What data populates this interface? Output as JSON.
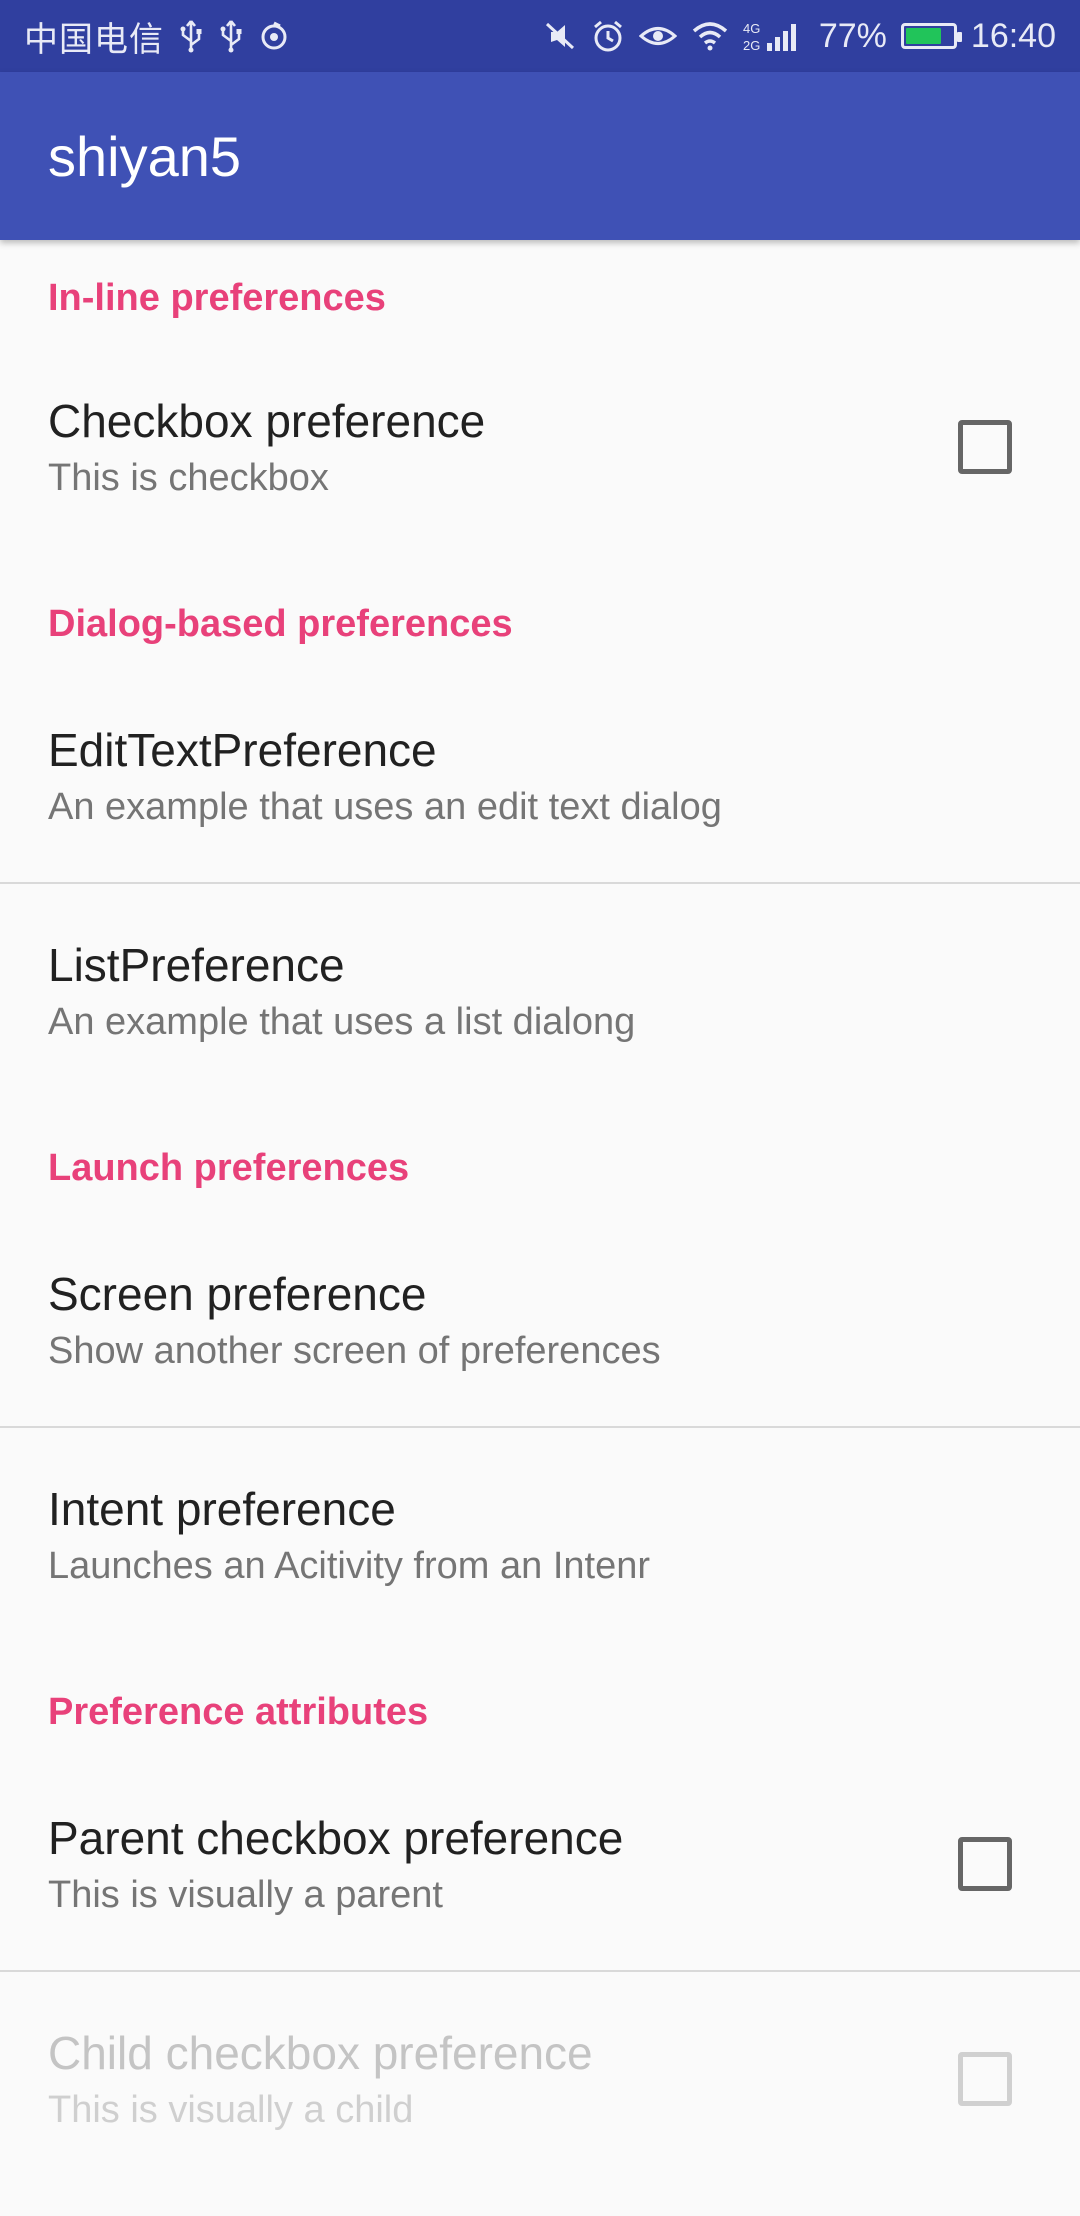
{
  "status_bar": {
    "carrier": "中国电信",
    "battery_percent": "77%",
    "battery_level": 0.77,
    "time": "16:40",
    "network": "4G",
    "icons_left": [
      "usb-icon",
      "usb-icon",
      "sync-icon"
    ],
    "icons_right": [
      "mute-icon",
      "alarm-icon",
      "eye-icon",
      "wifi-icon",
      "signal-icon",
      "battery-icon"
    ]
  },
  "app_bar": {
    "title": "shiyan5",
    "color": "#3f51b5",
    "status_color": "#303f9f"
  },
  "accent_color": "#e8417a",
  "categories": [
    {
      "title": "In-line preferences",
      "items": [
        {
          "title": "Checkbox preference",
          "summary": "This is checkbox",
          "checked": false
        }
      ]
    },
    {
      "title": "Dialog-based preferences",
      "items": [
        {
          "title": "EditTextPreference",
          "summary": "An example that uses an edit text dialog"
        },
        {
          "title": "ListPreference",
          "summary": "An example that uses a list dialong"
        }
      ]
    },
    {
      "title": "Launch preferences",
      "items": [
        {
          "title": "Screen preference",
          "summary": "Show another screen of preferences"
        },
        {
          "title": "Intent preference",
          "summary": "Launches an Acitivity from an Intenr"
        }
      ]
    },
    {
      "title": "Preference attributes",
      "items": [
        {
          "title": "Parent checkbox preference",
          "summary": "This is visually a parent",
          "checked": false
        },
        {
          "title": "Child checkbox preference",
          "summary": "This is visually a child",
          "checked": false,
          "enabled": false
        }
      ]
    }
  ]
}
